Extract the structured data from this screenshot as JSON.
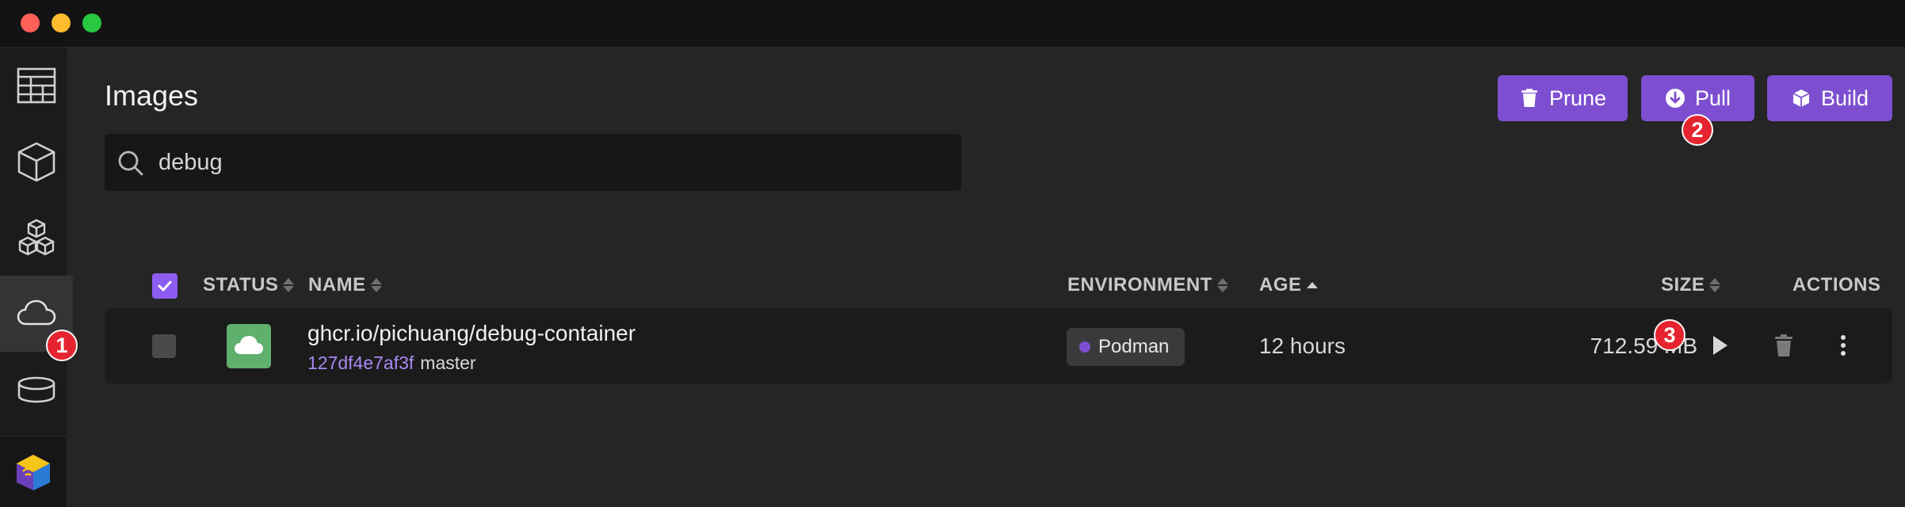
{
  "window": {
    "controls": [
      "close",
      "minimize",
      "zoom"
    ]
  },
  "sidebar": {
    "items": [
      {
        "name": "dashboard",
        "icon": "dashboard-icon"
      },
      {
        "name": "containers",
        "icon": "cube-icon"
      },
      {
        "name": "pods",
        "icon": "cubes-icon"
      },
      {
        "name": "images",
        "icon": "cloud-icon",
        "active": true
      },
      {
        "name": "volumes",
        "icon": "database-icon"
      }
    ],
    "bottom_icon": "podman-desktop-logo"
  },
  "page": {
    "title": "Images"
  },
  "toolbar": {
    "prune_label": "Prune",
    "pull_label": "Pull",
    "build_label": "Build"
  },
  "search": {
    "value": "debug",
    "placeholder": ""
  },
  "table": {
    "columns": {
      "status": "STATUS",
      "name": "NAME",
      "environment": "ENVIRONMENT",
      "age": "AGE",
      "size": "SIZE",
      "actions": "ACTIONS"
    },
    "select_all_checked": true,
    "sorted_by": "AGE",
    "rows": [
      {
        "status": "used",
        "name": "ghcr.io/pichuang/debug-container",
        "id": "127df4e7af3f",
        "tag": "master",
        "environment": "Podman",
        "age": "12 hours",
        "size": "712.59 MB",
        "checked": false
      }
    ]
  },
  "badges": {
    "one": "1",
    "two": "2",
    "three": "3"
  },
  "colors": {
    "accent": "#7d4fd0",
    "checkbox": "#8c5cf3",
    "image_id": "#a889f2",
    "status_green": "#5faf6d",
    "badge_red": "#e5242f"
  }
}
